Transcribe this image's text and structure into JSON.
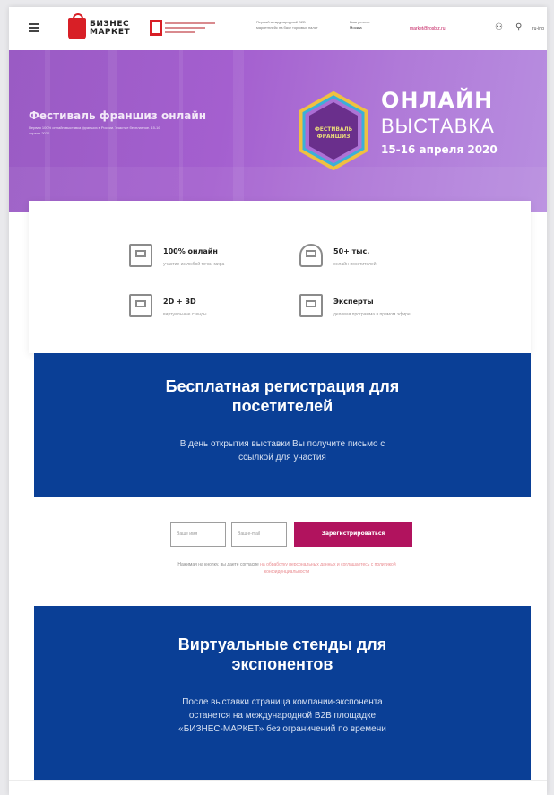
{
  "header": {
    "logo_line1": "БИЗНЕС",
    "logo_line2": "МАРКЕТ",
    "tagline": "Первый международный B2B маркетплейс на базе торговых палат",
    "region_label": "Ваш регион:",
    "region_value": "Москва",
    "email": "market@rosbiz.ru",
    "lang": "ru-ing"
  },
  "hero": {
    "title": "Фестиваль франшиз онлайн",
    "subtitle": "Первая 100% онлайн-выставка франшиз в России. Участие бесплатное. 15-16 апреля 2020",
    "badge_text": "ФЕСТИВАЛЬ ФРАНШИЗ",
    "online_label": "ОНЛАЙН",
    "exhibition_label": "ВЫСТАВКА",
    "dates": "15-16 апреля 2020"
  },
  "features": [
    {
      "title": "100% онлайн",
      "desc": "участие из любой точки мира",
      "icon": "monitor-icon"
    },
    {
      "title": "50+ тыс.",
      "desc": "онлайн-посетителей",
      "icon": "people-icon"
    },
    {
      "title": "2D + 3D",
      "desc": "виртуальные стенды",
      "icon": "cube-icon"
    },
    {
      "title": "Эксперты",
      "desc": "деловая программа в прямом эфире",
      "icon": "experts-icon"
    }
  ],
  "registration": {
    "heading": "Бесплатная регистрация для посетителей",
    "text": "В день открытия выставки Вы получите письмо с ссылкой для участия"
  },
  "form": {
    "name_placeholder": "Ваше имя",
    "email_placeholder": "Ваш e-mail",
    "submit_label": "Зарегистрироваться",
    "consent_text": "Нажимая на кнопку, вы даете согласие ",
    "consent_link": "на обработку персональных данных и соглашаетесь с политикой конфиденциальности"
  },
  "stands": {
    "heading": "Виртуальные стенды для экспонентов",
    "text": "После выставки страница компании-экспонента останется на международной B2B площадке «БИЗНЕС-МАРКЕТ» без ограничений по времени"
  },
  "colors": {
    "brand_red": "#d81f26",
    "hero_purple": "#a45fcf",
    "panel_blue": "#0a3f96",
    "button_pink": "#b1135e"
  }
}
